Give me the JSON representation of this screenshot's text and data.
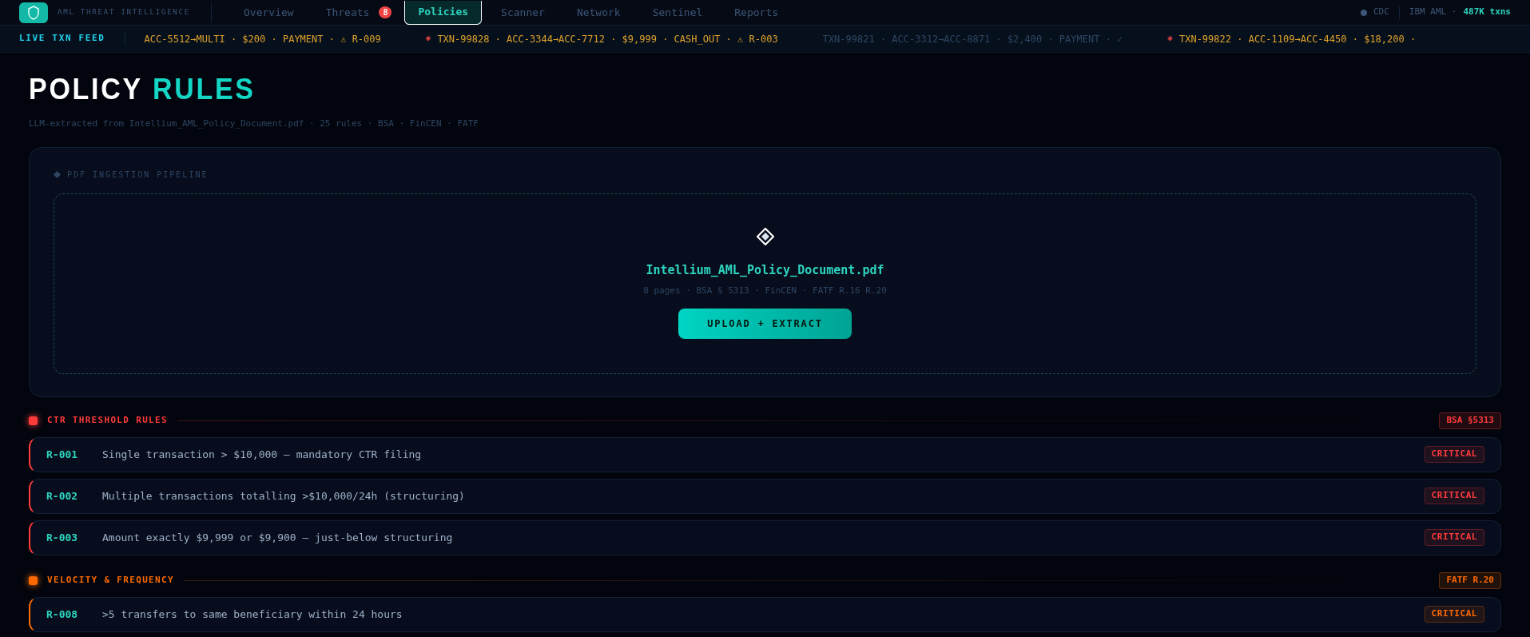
{
  "header": {
    "brand_subtitle": "AML THREAT INTELLIGENCE",
    "nav": [
      {
        "label": "Overview",
        "selected": false
      },
      {
        "label": "Threats",
        "selected": false,
        "badge": "8"
      },
      {
        "label": "Policies",
        "selected": true
      },
      {
        "label": "Scanner",
        "selected": false
      },
      {
        "label": "Network",
        "selected": false
      },
      {
        "label": "Sentinel",
        "selected": false
      },
      {
        "label": "Reports",
        "selected": false
      }
    ],
    "status": {
      "source": "CDC",
      "dataset": "IBM AML ·",
      "count": "487K txns"
    }
  },
  "ticker": {
    "label": "LIVE TXN FEED",
    "items": [
      {
        "kind": "flagged",
        "text": "ACC-5512→MULTI · $200 · PAYMENT · ⚠ R-009"
      },
      {
        "kind": "flagged",
        "marker": "◈",
        "text": "TXN-99828 · ACC-3344→ACC-7712 · $9,999 · CASH_OUT · ⚠ R-003"
      },
      {
        "kind": "clean",
        "text": "TXN-99821 · ACC-3312→ACC-8871 · $2,400 · PAYMENT · ✓"
      },
      {
        "kind": "flagged",
        "marker": "◈",
        "text": "TXN-99822 · ACC-1109→ACC-4450 · $18,200 ·"
      }
    ]
  },
  "page": {
    "title": "POLICY",
    "title_accent": "RULES",
    "subtitle": "LLM-extracted from Intellium_AML_Policy_Document.pdf · 25 rules · BSA · FinCEN · FATF"
  },
  "pipeline": {
    "label": "PDF INGESTION PIPELINE",
    "filename": "Intellium_AML_Policy_Document.pdf",
    "meta": "8 pages · BSA § 5313 · FinCEN · FATF R.16 R.20",
    "button": "UPLOAD + EXTRACT"
  },
  "sections": [
    {
      "title": "CTR THRESHOLD RULES",
      "color": "#ff3b3b",
      "tag": "BSA §5313",
      "rules": [
        {
          "id": "R-001",
          "text": "Single transaction > $10,000 — mandatory CTR filing",
          "severity": "CRITICAL"
        },
        {
          "id": "R-002",
          "text": "Multiple transactions totalling >$10,000/24h (structuring)",
          "severity": "CRITICAL"
        },
        {
          "id": "R-003",
          "text": "Amount exactly $9,999 or $9,900 — just-below structuring",
          "severity": "CRITICAL"
        }
      ]
    },
    {
      "title": "VELOCITY & FREQUENCY",
      "color": "#ff6a00",
      "tag": "FATF R.20",
      "rules": [
        {
          "id": "R-008",
          "text": ">5 transfers to same beneficiary within 24 hours",
          "severity": "CRITICAL"
        }
      ]
    }
  ]
}
